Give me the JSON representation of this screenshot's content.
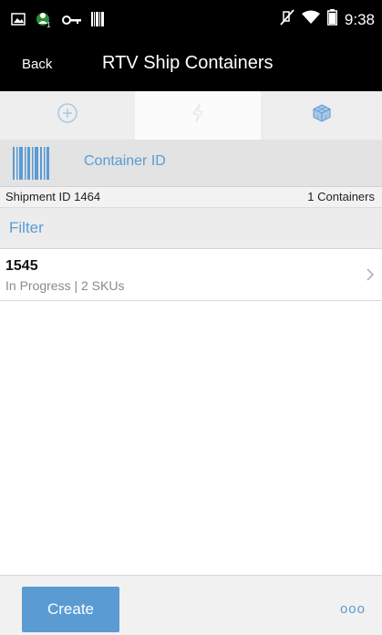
{
  "status_bar": {
    "time": "9:38",
    "icons": [
      "gallery-icon",
      "notification-icon",
      "key-icon",
      "barcode-icon",
      "mute-icon",
      "wifi-icon",
      "battery-icon"
    ]
  },
  "header": {
    "back_label": "Back",
    "title": "RTV Ship Containers"
  },
  "tabs": [
    {
      "icon": "add-circle-icon",
      "active": false
    },
    {
      "icon": "flash-icon",
      "active": true
    },
    {
      "icon": "cube-icon",
      "active": false
    }
  ],
  "scan": {
    "placeholder": "Container ID"
  },
  "info": {
    "shipment": "Shipment ID 1464",
    "containers": "1 Containers"
  },
  "filter": {
    "label": "Filter"
  },
  "list": {
    "items": [
      {
        "id": "1545",
        "subtitle": "In Progress | 2 SKUs"
      }
    ]
  },
  "footer": {
    "create_label": "Create",
    "more_label": "ooo"
  },
  "colors": {
    "accent": "#5a9bd4",
    "bar": "#000000"
  }
}
